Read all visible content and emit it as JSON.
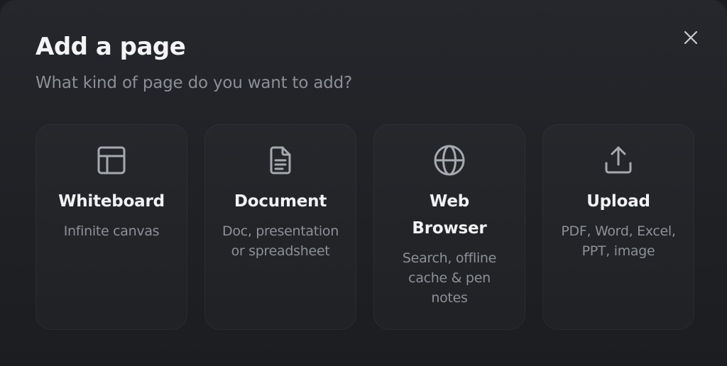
{
  "dialog": {
    "title": "Add a page",
    "subtitle": "What kind of page do you want to add?",
    "close_icon": "close-icon"
  },
  "options": [
    {
      "id": "whiteboard",
      "icon": "layout-icon",
      "title": "Whiteboard",
      "description": "Infinite canvas"
    },
    {
      "id": "document",
      "icon": "document-icon",
      "title": "Document",
      "description": "Doc, presentation or spreadsheet"
    },
    {
      "id": "web-browser",
      "icon": "globe-icon",
      "title": "Web Browser",
      "description": "Search, offline cache & pen notes"
    },
    {
      "id": "upload",
      "icon": "upload-icon",
      "title": "Upload",
      "description": "PDF, Word, Excel, PPT, image"
    }
  ],
  "colors": {
    "background": "#1f2125",
    "card_border": "#2c2e33",
    "title": "#f2f2f4",
    "muted": "#8d9097",
    "icon": "#a6a9af"
  }
}
